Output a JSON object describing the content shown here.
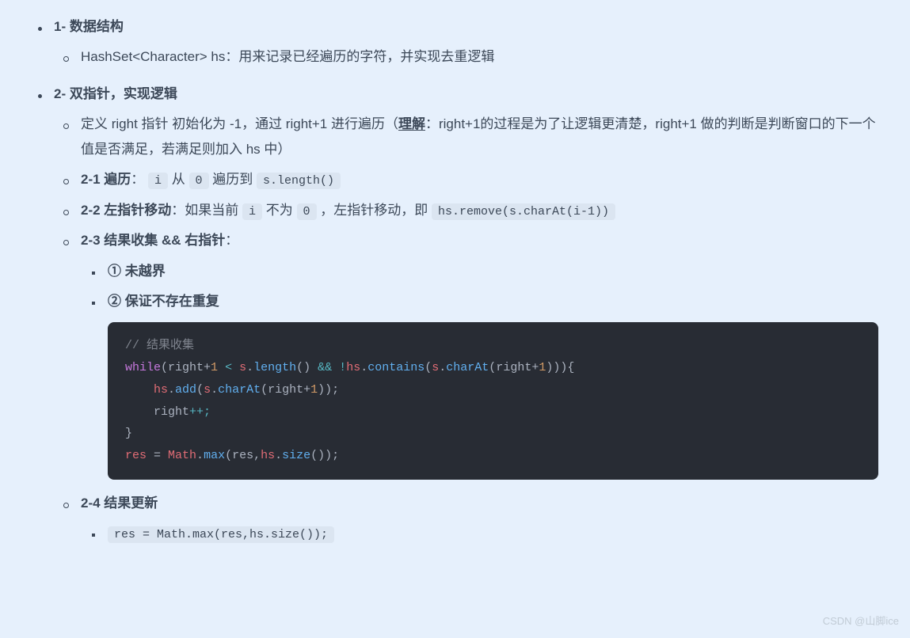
{
  "section1": {
    "title": "1- 数据结构",
    "item1": "HashSet<Character> hs：用来记录已经遍历的字符，并实现去重逻辑"
  },
  "section2": {
    "title": "2- 双指针，实现逻辑",
    "def_part1": "定义 right 指针 初始化为 -1，通过 right+1 进行遍历（",
    "def_underline": "理解",
    "def_part2": "：right+1的过程是为了让逻辑更清楚，right+1 做的判断是判断窗口的下一个值是否满足，若满足则加入 hs 中）",
    "s2_1_label": "2-1 遍历",
    "s2_1_colon": "：",
    "s2_1_text1": " 从 ",
    "s2_1_text2": " 遍历到 ",
    "s2_1_code_i": "i",
    "s2_1_code_0": "0",
    "s2_1_code_len": "s.length()",
    "s2_2_label": "2-2 左指针移动",
    "s2_2_text1": "：如果当前 ",
    "s2_2_code_i": "i",
    "s2_2_text2": " 不为 ",
    "s2_2_code_0": "0",
    "s2_2_text3": " ，左指针移动，即 ",
    "s2_2_code_remove": "hs.remove(s.charAt(i-1))",
    "s2_3_label": "2-3 结果收集 && 右指针",
    "s2_3_colon": "：",
    "s2_3_sub1": "① 未越界",
    "s2_3_sub2": "② 保证不存在重复",
    "s2_4_label": "2-4 结果更新",
    "s2_4_code": "res = Math.max(res,hs.size());"
  },
  "code": {
    "comment": "// 结果收集",
    "kw_while": "while",
    "paren_open": "(",
    "right_plus": "right+",
    "one_a": "1",
    "lt": " < ",
    "s": "s",
    "dot1": ".",
    "length": "length",
    "lp": "() ",
    "ampamp": "&&",
    "sp": " ",
    "bang": "!",
    "hs": "hs",
    "dot2": ".",
    "contains": "contains",
    "po": "(",
    "s2": "s",
    "dot3": ".",
    "charAt": "charAt",
    "po2": "(",
    "rp1": "right+",
    "one_b": "1",
    "pc": "))){",
    "indent": "    ",
    "hs2": "hs",
    "dot4": ".",
    "add": "add",
    "po3": "(",
    "s3": "s",
    "dot5": ".",
    "charAt2": "charAt",
    "po4": "(",
    "rp2": "right+",
    "one_c": "1",
    "pc2": "));",
    "right": "right",
    "pp": "++;",
    "brace_close": "}",
    "res": "res",
    "eq": " = ",
    "Math": "Math",
    "dot6": ".",
    "max": "max",
    "po5": "(",
    "res2": "res",
    "comma": ",",
    "hs3": "hs",
    "dot7": ".",
    "size": "size",
    "pc3": "());"
  },
  "watermark": "CSDN @山脚ice"
}
